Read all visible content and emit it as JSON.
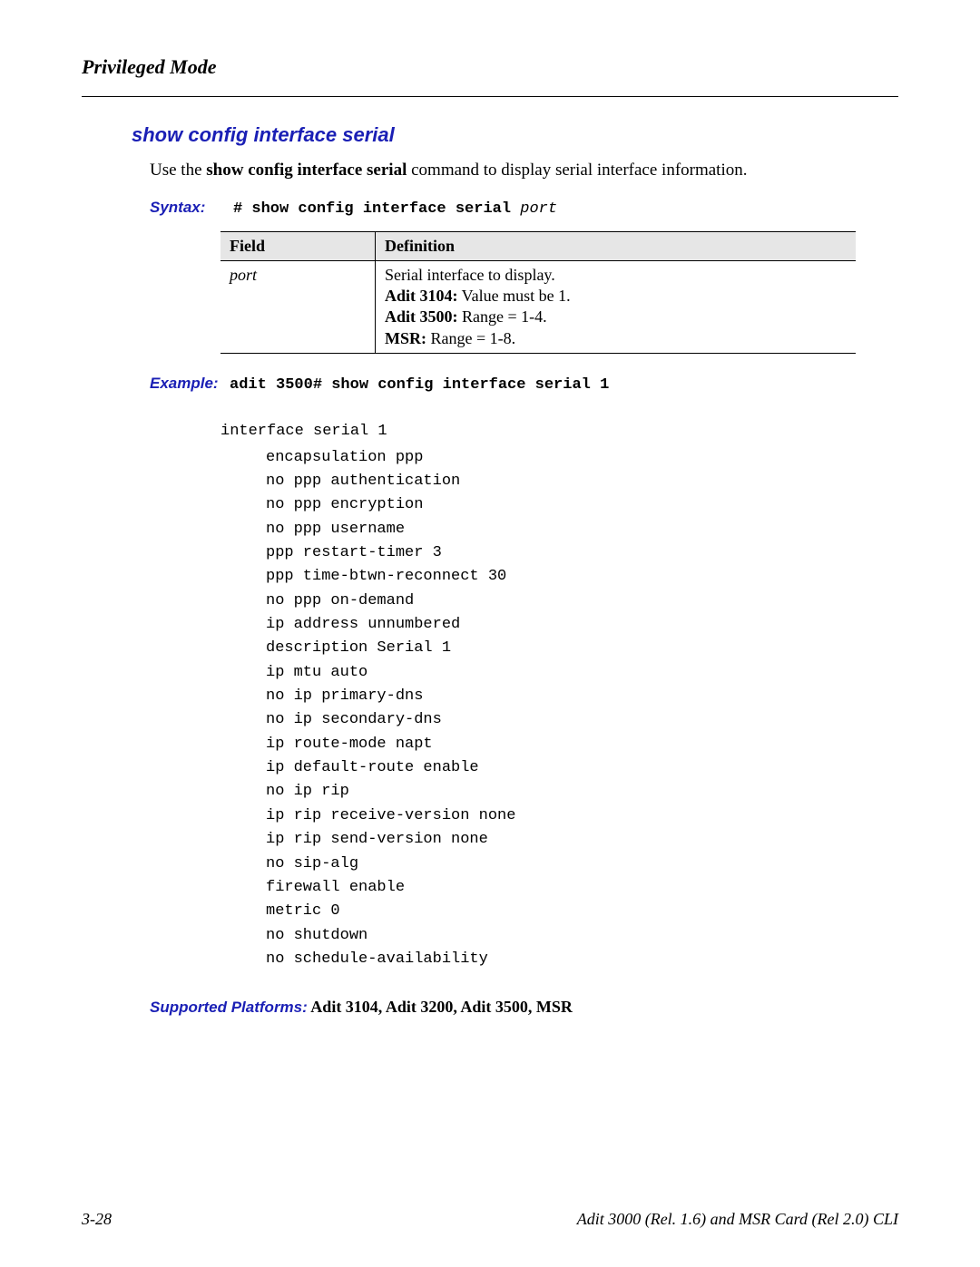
{
  "running_head": "Privileged Mode",
  "heading": "show config interface serial",
  "intro_pre": "Use the ",
  "intro_bold": "show config interface serial",
  "intro_post": " command to display serial interface information.",
  "syntax": {
    "label": "Syntax:",
    "cmd_prefix": "# show config interface serial ",
    "cmd_arg": "port"
  },
  "table": {
    "header_field": "Field",
    "header_def": "Definition",
    "row": {
      "field": "port",
      "def_line1": "Serial interface to display.",
      "def2_strong": "Adit 3104:",
      "def2_rest": "  Value must be 1.",
      "def3_strong": "Adit 3500:",
      "def3_rest": "  Range = 1-4.",
      "def4_strong": "MSR:",
      "def4_rest": "  Range = 1-8."
    }
  },
  "example": {
    "label": "Example:",
    "cmd": "adit 3500# show config interface serial 1"
  },
  "output": {
    "head": "interface serial 1",
    "lines": [
      "encapsulation ppp",
      "no ppp authentication",
      "no ppp encryption",
      "no ppp username",
      "ppp restart-timer 3",
      "ppp time-btwn-reconnect  30",
      "no ppp on-demand",
      "ip address unnumbered",
      "description Serial 1",
      "ip mtu auto",
      "no ip primary-dns",
      "no ip secondary-dns",
      "ip route-mode napt",
      "ip default-route enable",
      "no ip rip",
      "ip rip receive-version none",
      "ip rip send-version none",
      "no sip-alg",
      "firewall enable",
      "metric 0",
      "no shutdown",
      "no schedule-availability"
    ]
  },
  "platforms": {
    "label": "Supported Platforms:",
    "value": "  Adit 3104, Adit 3200, Adit 3500, MSR"
  },
  "footer": {
    "left": "3-28",
    "right": "Adit 3000 (Rel. 1.6) and MSR Card (Rel 2.0) CLI"
  }
}
